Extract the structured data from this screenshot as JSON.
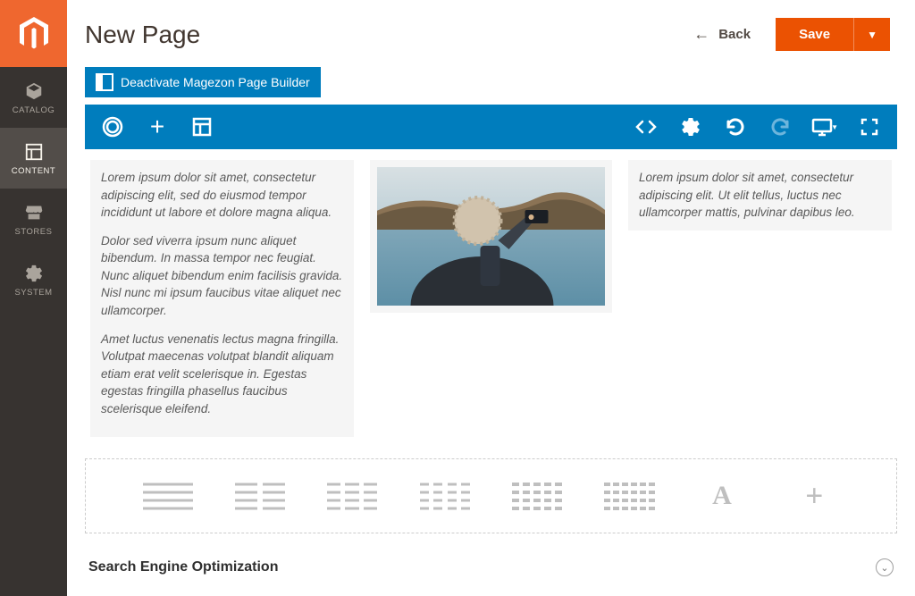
{
  "header": {
    "page_title": "New Page",
    "back_label": "Back",
    "save_label": "Save"
  },
  "sidebar": {
    "items": [
      {
        "id": "catalog",
        "label": "CATALOG",
        "icon": "cube-icon"
      },
      {
        "id": "content",
        "label": "CONTENT",
        "icon": "layout-icon"
      },
      {
        "id": "stores",
        "label": "STORES",
        "icon": "storefront-icon"
      },
      {
        "id": "system",
        "label": "SYSTEM",
        "icon": "gear-icon"
      }
    ],
    "active": "content"
  },
  "builder": {
    "deactivate_label": "Deactivate Magezon Page Builder",
    "toolbar_icons": [
      "circle-icon",
      "plus-icon",
      "layout-icon",
      "code-icon",
      "gear-icon",
      "undo-icon",
      "redo-icon",
      "monitor-icon",
      "fullscreen-icon"
    ]
  },
  "stage": {
    "col_left": [
      "Lorem ipsum dolor sit amet, consectetur adipiscing elit, sed do eiusmod tempor incididunt ut labore et dolore magna aliqua.",
      "Dolor sed viverra ipsum nunc aliquet bibendum. In massa tempor nec feugiat. Nunc aliquet bibendum enim facilisis gravida. Nisl nunc mi ipsum faucibus vitae aliquet nec ullamcorper.",
      "Amet luctus venenatis lectus magna fringilla. Volutpat maecenas volutpat blandit aliquam etiam erat velit scelerisque in. Egestas egestas fringilla phasellus faucibus scelerisque eleifend."
    ],
    "col_right": [
      "Lorem ipsum dolor sit amet, consectetur adipiscing elit. Ut elit tellus, luctus nec ullamcorper mattis, pulvinar dapibus leo."
    ],
    "image_alt": "person-photographing-water"
  },
  "layout_options": [
    "layout-1col",
    "layout-2col",
    "layout-3col",
    "layout-4col",
    "layout-5col",
    "layout-6col",
    "text-element",
    "add-element"
  ],
  "seo": {
    "title": "Search Engine Optimization"
  }
}
